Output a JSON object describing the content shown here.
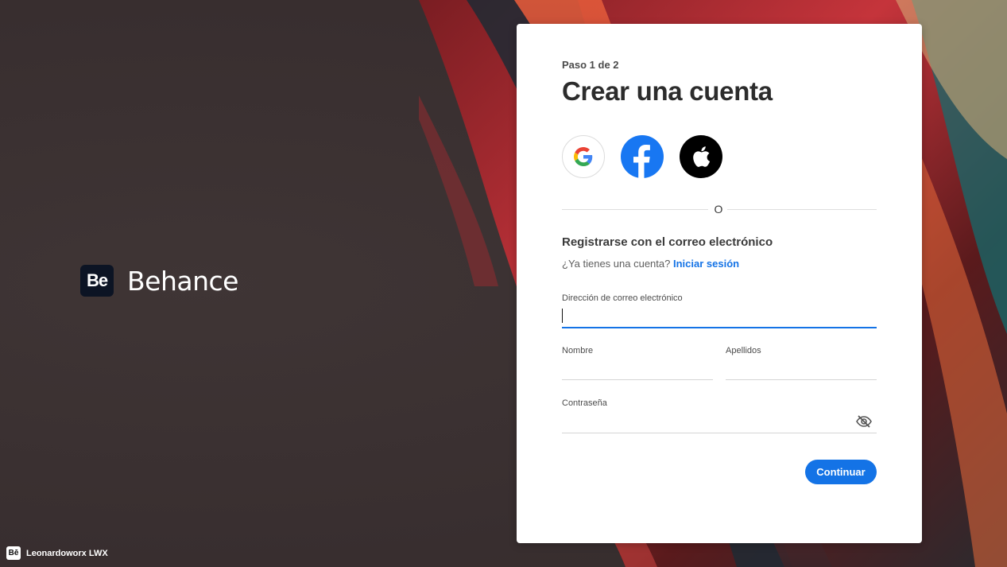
{
  "brand": {
    "logo_text": "Be",
    "name": "Behance"
  },
  "credit": {
    "logo_text": "Bē",
    "name": "Leonardoworx LWX"
  },
  "form": {
    "step": "Paso 1 de 2",
    "title": "Crear una cuenta",
    "socials": [
      {
        "name": "google-icon"
      },
      {
        "name": "facebook-icon"
      },
      {
        "name": "apple-icon"
      }
    ],
    "divider_text": "O",
    "section_title": "Registrarse con el correo electrónico",
    "have_account": "¿Ya tienes una cuenta?",
    "signin_link": "Iniciar sesión",
    "email_label": "Dirección de correo electrónico",
    "email_value": "",
    "first_name_label": "Nombre",
    "first_name_value": "",
    "last_name_label": "Apellidos",
    "last_name_value": "",
    "password_label": "Contraseña",
    "password_value": "",
    "password_toggle_icon": "eye-off-icon",
    "continue_label": "Continuar"
  },
  "colors": {
    "accent": "#1473e6",
    "facebook": "#1877f2",
    "background": "#3d3333"
  }
}
